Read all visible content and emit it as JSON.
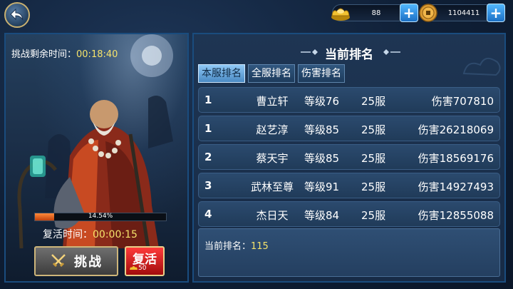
{
  "currency": {
    "gold_value": "88",
    "coin_value": "1104411"
  },
  "left": {
    "challenge_time_label": "挑战剩余时间：",
    "challenge_time_value": "00:18:40",
    "revive_progress_text": "14.54%",
    "revive_progress": 0.1454,
    "revive_time_label": "复活时间：",
    "revive_time_value": "00:00:15",
    "challenge_button": "挑战",
    "revive_button": "复活",
    "revive_cost": "50"
  },
  "right": {
    "title": "当前排名",
    "tabs": [
      "本服排名",
      "全服排名",
      "伤害排名"
    ],
    "active_tab": 0,
    "rows": [
      {
        "rank": "1",
        "name": "曹立轩",
        "level": "等级76",
        "server": "25服",
        "damage": "伤害707810"
      },
      {
        "rank": "1",
        "name": "赵艺淳",
        "level": "等级85",
        "server": "25服",
        "damage": "伤害26218069"
      },
      {
        "rank": "2",
        "name": "蔡天宇",
        "level": "等级85",
        "server": "25服",
        "damage": "伤害18569176"
      },
      {
        "rank": "3",
        "name": "武林至尊",
        "level": "等级91",
        "server": "25服",
        "damage": "伤害14927493"
      },
      {
        "rank": "4",
        "name": "杰日天",
        "level": "等级84",
        "server": "25服",
        "damage": "伤害12855088"
      }
    ],
    "my_rank_label": "当前排名：",
    "my_rank_value": "115"
  },
  "icons": {
    "back": "back-arrow-icon",
    "gold": "gold-ingot-icon",
    "coin": "copper-coin-icon",
    "plus": "plus-icon",
    "swords": "crossed-swords-icon"
  },
  "colors": {
    "accent_yellow": "#f5e36b",
    "revive_red": "#d31a1a",
    "plus_blue": "#2a8ae0",
    "progress_orange": "#e8651a"
  }
}
